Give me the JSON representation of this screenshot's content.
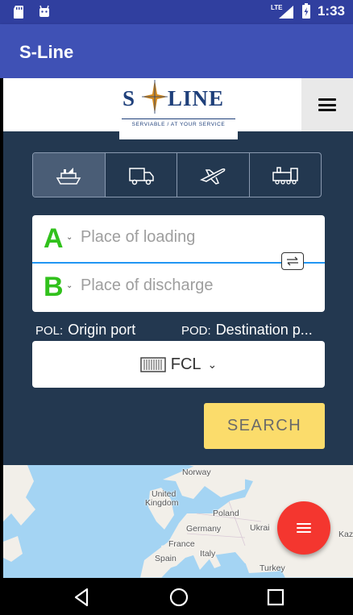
{
  "status_bar": {
    "left_icons": [
      "sd-card-icon",
      "android-icon"
    ],
    "network": "LTE",
    "time": "1:33"
  },
  "app_bar": {
    "title": "S-Line"
  },
  "site": {
    "logo": {
      "left": "S",
      "right": "LINE",
      "tagline": "SERVIABLE / AT YOUR SERVICE"
    },
    "menu_icon": "hamburger-icon"
  },
  "transport_tabs": [
    {
      "name": "sea",
      "icon": "ship-icon",
      "active": true
    },
    {
      "name": "road",
      "icon": "truck-icon",
      "active": false
    },
    {
      "name": "air",
      "icon": "plane-icon",
      "active": false
    },
    {
      "name": "rail",
      "icon": "train-icon",
      "active": false
    }
  ],
  "form": {
    "loading": {
      "letter": "A",
      "placeholder": "Place of loading",
      "chevron": "⌄"
    },
    "discharge": {
      "letter": "B",
      "placeholder": "Place of discharge",
      "chevron": "⌄"
    },
    "pol": {
      "tag": "POL:",
      "value": "Origin port"
    },
    "pod": {
      "tag": "POD:",
      "value": "Destination p..."
    },
    "container": {
      "label": "FCL",
      "chevron": "⌄"
    },
    "search_label": "SEARCH"
  },
  "map": {
    "labels": {
      "norway": "Norway",
      "uk1": "United",
      "uk2": "Kingdom",
      "poland": "Poland",
      "germany": "Germany",
      "ukraine": "Ukrai",
      "france": "France",
      "italy": "Italy",
      "spain": "Spain",
      "turkey": "Turkey",
      "kaz": "Kaz"
    }
  },
  "colors": {
    "status_bar": "#303f9f",
    "app_bar": "#3f51b5",
    "panel": "#233850",
    "accent_green": "#31c11c",
    "search": "#fbdc6b",
    "fab": "#f4362f"
  }
}
